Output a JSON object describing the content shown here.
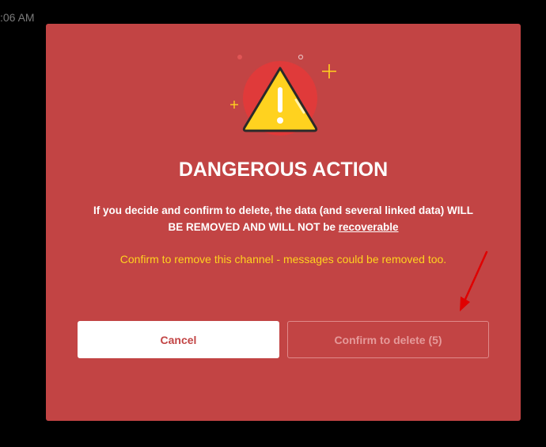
{
  "clock": {
    "time": ":06 AM"
  },
  "dialog": {
    "title": "DANGEROUS ACTION",
    "description_main": "If you decide and confirm to delete, the data (and several linked data) WILL BE REMOVED AND WILL NOT be",
    "description_link": "recoverable",
    "subtext": "Confirm to remove this channel - messages could be removed too.",
    "cancel_label": "Cancel",
    "confirm_label": "Confirm to delete (5)"
  },
  "icons": {
    "warning": "warning-triangle-icon",
    "sparkle": "sparkle-icon",
    "arrow": "red-arrow-annotation"
  },
  "colors": {
    "modal_bg": "#c24444",
    "warning_yellow": "#ffd21f",
    "subtext": "#ffd21f",
    "arrow": "#e00000"
  }
}
